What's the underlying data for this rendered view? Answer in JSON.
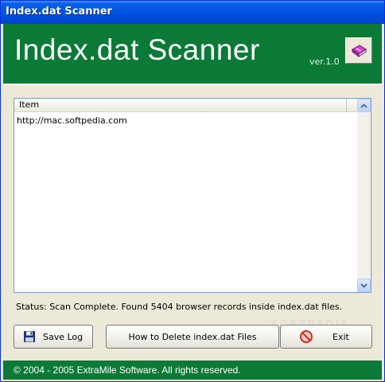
{
  "window": {
    "title": "Index.dat Scanner"
  },
  "banner": {
    "title": "Index.dat Scanner",
    "version": "ver.1.0",
    "icon": "book-icon"
  },
  "list": {
    "columns": [
      "Item"
    ],
    "rows": [
      "http://mac.softpedia.com"
    ]
  },
  "status": "Status: Scan Complete. Found 5404 browser records inside index.dat files.",
  "buttons": {
    "save_log": "Save Log",
    "how_to_delete": "How to Delete index.dat Files",
    "exit": "Exit"
  },
  "watermark": "SOFTPEDIA",
  "footer": "© 2004 - 2005 ExtraMile Software. All rights reserved.",
  "colors": {
    "accent": "#0b7a36",
    "titlebar": "#0054e3"
  }
}
